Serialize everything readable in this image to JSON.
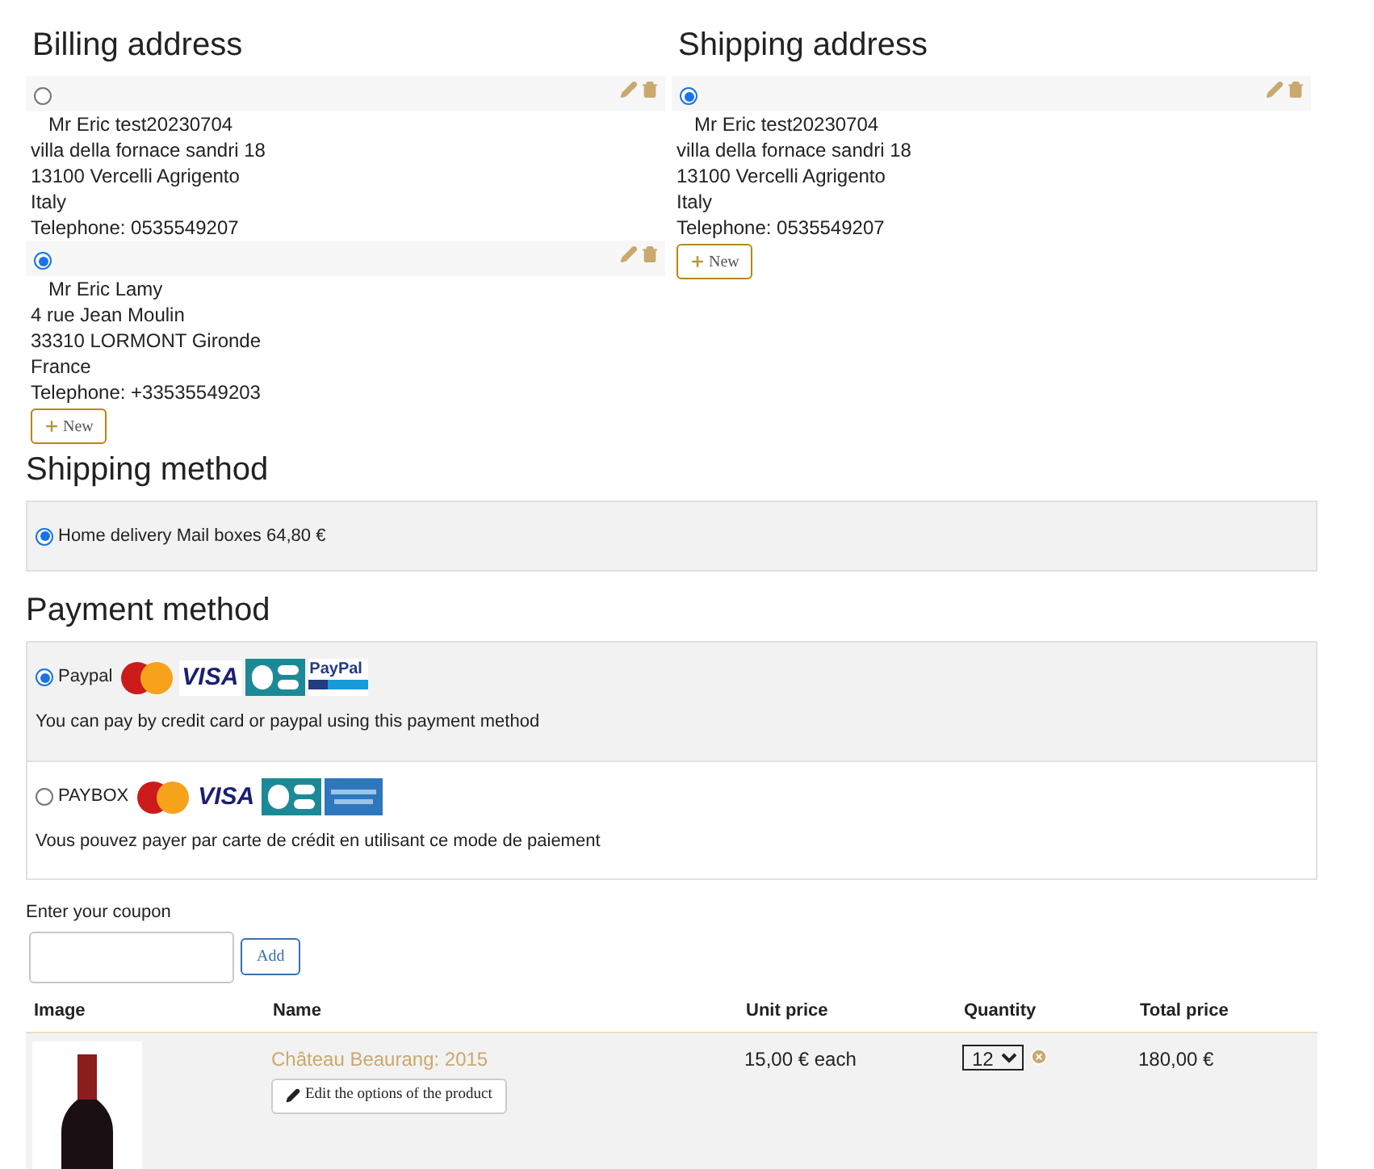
{
  "billing": {
    "title": "Billing address",
    "addresses": [
      {
        "selected": false,
        "name": "Mr Eric test20230704",
        "lines": [
          "villa della fornace sandri 18",
          "13100 Vercelli Agrigento",
          "Italy",
          "Telephone: 0535549207"
        ]
      },
      {
        "selected": true,
        "name": "Mr Eric Lamy",
        "lines": [
          "4 rue Jean Moulin",
          "33310 LORMONT Gironde",
          "France",
          "Telephone: +33535549203"
        ]
      }
    ],
    "new_button": "New"
  },
  "shipping": {
    "title": "Shipping address",
    "addresses": [
      {
        "selected": true,
        "name": "Mr Eric test20230704",
        "lines": [
          "villa della fornace sandri 18",
          "13100 Vercelli Agrigento",
          "Italy",
          "Telephone: 0535549207"
        ]
      }
    ],
    "new_button": "New"
  },
  "shipping_method": {
    "title": "Shipping method",
    "options": [
      {
        "label": "Home delivery Mail boxes 64,80 €",
        "selected": true
      }
    ]
  },
  "payment_method": {
    "title": "Payment method",
    "options": [
      {
        "label": "Paypal",
        "selected": true,
        "logos": [
          {
            "kind": "mastercard"
          },
          {
            "kind": "visa",
            "text": "VISA"
          },
          {
            "kind": "cb"
          },
          {
            "kind": "paypal",
            "text": "PayPal"
          }
        ],
        "description": "You can pay by credit card or paypal using this payment method"
      },
      {
        "label": "PAYBOX",
        "selected": false,
        "logos": [
          {
            "kind": "mastercard"
          },
          {
            "kind": "visa",
            "text": "VISA"
          },
          {
            "kind": "cb"
          },
          {
            "kind": "amex"
          }
        ],
        "description": "Vous pouvez payer par carte de crédit en utilisant ce mode de paiement"
      }
    ]
  },
  "coupon": {
    "label": "Enter your coupon",
    "button": "Add"
  },
  "cart": {
    "columns": [
      "Image",
      "Name",
      "Unit price",
      "Quantity",
      "Total price"
    ],
    "rows": [
      {
        "name": "Château Beaurang: 2015",
        "edit_button": "Edit the options of the product",
        "unit_price": "15,00 € each",
        "quantity": "12",
        "total": "180,00 €"
      }
    ]
  }
}
